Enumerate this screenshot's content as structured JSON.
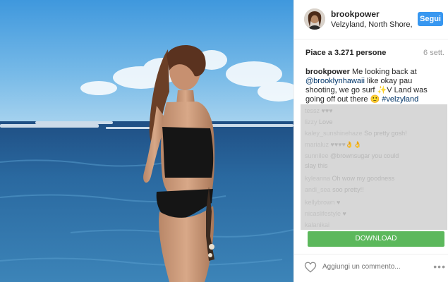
{
  "post": {
    "username": "brookpower",
    "location": "Velzyland, North Shore, H...",
    "follow_label": "Segui",
    "likes": "Piace a 3.271 persone",
    "time_ago": "6 sett.",
    "caption": {
      "username": "brookpower",
      "text_1": " Me looking back at ",
      "mention": "@brooklynhawaii",
      "text_2": " like okay pau shooting, we go surf ",
      "emoji": "✨",
      "text_3": "V Land was going off out there ",
      "emoji_2": "🙂",
      "hashtag": " #velzyland"
    }
  },
  "comments": [
    {
      "user": "tessz",
      "text": "♥♥♥"
    },
    {
      "user": "lizzy",
      "text": "Love"
    },
    {
      "user": "kaley_sunshinehaze",
      "text": "So pretty gosh!"
    },
    {
      "user": "marialuz",
      "text": "♥♥♥♥👌👌"
    },
    {
      "user": "sunnilee",
      "text": "@brownsugar you could"
    },
    {
      "user": "",
      "text": "slay this"
    },
    {
      "user": "kyleanna",
      "text": "Oh wow my goodness"
    },
    {
      "user": "andi_sea",
      "text": "soo pretty!!"
    },
    {
      "user": "kellybrown",
      "text": "♥"
    },
    {
      "user": "nicaslifestyle",
      "text": "♥"
    },
    {
      "user": "kalanikai",
      "text": ""
    }
  ],
  "download_label": "DOWNLOAD",
  "footer": {
    "comment_placeholder": "Aggiungi un commento...",
    "heart_icon": "heart-outline-icon",
    "more_icon": "more-options-icon",
    "more_label": "•••"
  },
  "colors": {
    "accent": "#3897f0",
    "download": "#5cb85c",
    "link": "#003569"
  }
}
